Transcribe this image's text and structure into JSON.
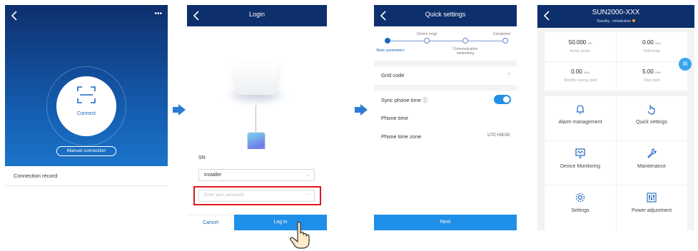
{
  "screen1": {
    "connect_label": "Connect",
    "manual_connection": "Manual connection",
    "connection_record": "Connection record",
    "more_menu": "•••"
  },
  "screen2": {
    "title": "Login",
    "sn_label": "SN",
    "user_value": "Installer",
    "password_placeholder": "Enter your password",
    "cancel_label": "Cancel",
    "login_label": "Log in"
  },
  "screen3": {
    "title": "Quick settings",
    "steps": [
      {
        "label": "Basic parameters",
        "state": "active"
      },
      {
        "label": "Device mngt",
        "state": "pending"
      },
      {
        "label": "Communication networking",
        "state": "pending"
      },
      {
        "label": "Completed",
        "state": "pending"
      }
    ],
    "grid_code_label": "Grid code",
    "sync_phone_time_label": "Sync phone time ⓘ",
    "sync_phone_time_on": true,
    "phone_time_label": "Phone time",
    "phone_time_zone_label": "Phone time zone",
    "phone_time_zone_value": "UTC+08:00",
    "next_label": "Next"
  },
  "screen4": {
    "title": "SUN2000-XXX",
    "status": "Standby : initialization",
    "stats": [
      {
        "value": "50.000",
        "unit": "kW",
        "label": "Active power"
      },
      {
        "value": "0.00",
        "unit": "kWh",
        "label": "Yield today"
      },
      {
        "value": "0.00",
        "unit": "kWh",
        "label": "Monthly energy yield"
      },
      {
        "value": "5.00",
        "unit": "kWh",
        "label": "Total yield"
      }
    ],
    "menu": [
      {
        "label": "Alarm management",
        "icon": "alarm-bell-icon"
      },
      {
        "label": "Quick settings",
        "icon": "hand-tap-icon"
      },
      {
        "label": "Device Monitoring",
        "icon": "monitor-icon"
      },
      {
        "label": "Maintenance",
        "icon": "wrench-icon"
      },
      {
        "label": "Settings",
        "icon": "gear-icon"
      },
      {
        "label": "Power adjustment",
        "icon": "sliders-icon"
      }
    ]
  },
  "colors": {
    "navbar": "#0d2f6b",
    "accent": "#1f8fe8",
    "highlight_box": "#e0171f",
    "arrow": "#2e7bd6"
  }
}
